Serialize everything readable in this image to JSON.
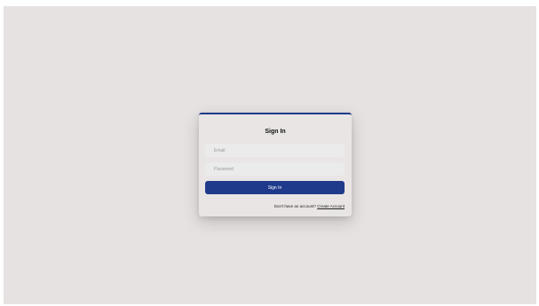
{
  "signin": {
    "title": "Sign In",
    "email_placeholder": "Email",
    "password_placeholder": "Password",
    "submit_label": "Sign In",
    "footer_text": "Don't have an account?",
    "create_account_label": "Create Account"
  },
  "colors": {
    "accent": "#1f3a8a",
    "background": "#e6e2e1",
    "card": "#e8e5e4"
  }
}
